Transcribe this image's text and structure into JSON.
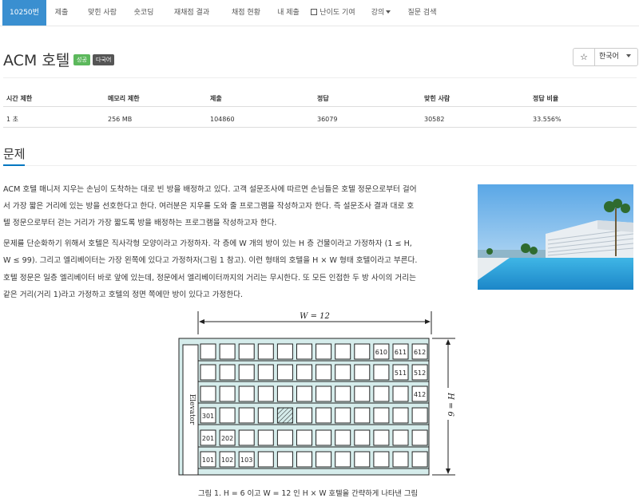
{
  "nav": {
    "items": [
      {
        "label": "10250번",
        "active": true
      },
      {
        "label": "제출"
      },
      {
        "label": "맞힌 사람"
      },
      {
        "label": "숏코딩"
      },
      {
        "label": "재채점 결과"
      },
      {
        "label": "채점 현황"
      },
      {
        "label": "내 제출"
      },
      {
        "label": "난이도 기여",
        "icon": "external-link-icon"
      },
      {
        "label": "강의",
        "dropdown": true
      },
      {
        "label": "질문 검색"
      }
    ]
  },
  "problem": {
    "title": "ACM 호텔",
    "badges": [
      "성공",
      "다국어"
    ],
    "star_icon": "☆",
    "language": "한국어"
  },
  "stats": {
    "headers": [
      "시간 제한",
      "메모리 제한",
      "제출",
      "정답",
      "맞힌 사람",
      "정답 비율"
    ],
    "values": [
      "1 초",
      "256 MB",
      "104860",
      "36079",
      "30582",
      "33.556%"
    ]
  },
  "section": {
    "title": "문제",
    "paragraphs": [
      "ACM 호텔 매니저 지우는 손님이 도착하는 대로 빈 방을 배정하고 있다. 고객 설문조사에 따르면 손님들은 호텔 정문으로부터 걸어",
      "서 가장 짧은 거리에 있는 방을 선호한다고 한다. 여러분은 지우를 도와 줄 프로그램을 작성하고자 한다. 즉 설문조사 결과 대로 호",
      "텔 정문으로부터 걷는 거리가 가장 짧도록 방을 배정하는 프로그램을 작성하고자 한다.",
      "문제를 단순화하기 위해서 호텔은 직사각형 모양이라고 가정하자. 각 층에 W 개의 방이 있는 H 층 건물이라고 가정하자 (1 ≤ H,",
      "W ≤ 99). 그리고 엘리베이터는 가장 왼쪽에 있다고 가정하자(그림 1 참고). 이런 형태의 호텔을 H × W 형태 호텔이라고 부른다.",
      "호텔 정문은 일층 엘리베이터 바로 앞에 있는데, 정문에서 엘리베이터까지의 거리는 무시한다. 또 모든 인접한 두 방 사이의 거리는",
      "같은 거리(거리 1)라고 가정하고 호텔의 정면 쪽에만 방이 있다고 가정한다."
    ]
  },
  "figure": {
    "w_label": "W = 12",
    "h_label": "H = 6",
    "elevator_label": "Elevator",
    "rooms": {
      "610": "610",
      "611": "611",
      "612": "612",
      "511": "511",
      "512": "512",
      "412": "412",
      "301": "301",
      "201": "201",
      "202": "202",
      "101": "101",
      "102": "102",
      "103": "103"
    },
    "caption": "그림 1. H = 6 이고 W = 12 인 H × W 호텔을 간략하게 나타낸 그림",
    "colors": {
      "wall": "#d5eceb",
      "line": "#222"
    }
  }
}
